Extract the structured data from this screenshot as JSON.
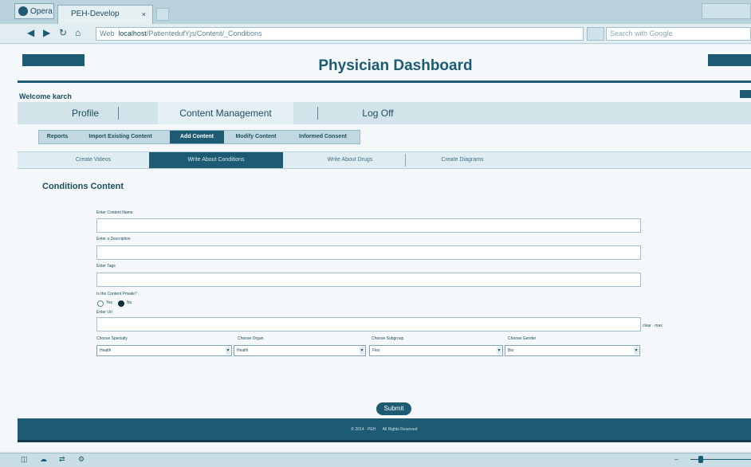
{
  "browser": {
    "menu_label": "Opera",
    "tab_title": "PEH-Develop",
    "tab_close": "×",
    "web_label": "Web",
    "url_host": "localhost",
    "url_path": "/PatientedufYjs/Content/_Conditions",
    "search_placeholder": "Search with Google"
  },
  "header": {
    "title": "Physician Dashboard",
    "welcome": "Welcome karch"
  },
  "main_nav": {
    "items": [
      {
        "label": "Profile"
      },
      {
        "label": "Content Management"
      },
      {
        "label": "Log Off"
      }
    ]
  },
  "sub_nav": {
    "items": [
      {
        "label": "Reports"
      },
      {
        "label": "Import Existing Content"
      },
      {
        "label": "Add Content"
      },
      {
        "label": "Modify Content"
      },
      {
        "label": "Informed Consent"
      }
    ]
  },
  "third_nav": {
    "items": [
      {
        "label": "Create Videos"
      },
      {
        "label": "Write About Conditions"
      },
      {
        "label": "Write About Drugs"
      },
      {
        "label": "Create Diagrams"
      }
    ]
  },
  "section_title": "Conditions Content",
  "form": {
    "fields": [
      {
        "label": "Enter Content Name"
      },
      {
        "label": "Enter a Description"
      },
      {
        "label": "Enter Tags"
      }
    ],
    "radio_question": "Is the Content Private?",
    "radio_yes": "Yes",
    "radio_no": "No",
    "url_label": "Enter Url",
    "url_side_text": "clear · max",
    "selects": [
      {
        "label": "Choose Specialty",
        "value": "Health"
      },
      {
        "label": "Choose Organ",
        "value": "Health"
      },
      {
        "label": "Choose Subgroup",
        "value": "Flex"
      },
      {
        "label": "Choose Gender",
        "value": "Bio"
      }
    ],
    "submit_label": "Submit"
  },
  "footer": {
    "left": "© 2014 · PEH",
    "right": "All Rights Reserved"
  }
}
